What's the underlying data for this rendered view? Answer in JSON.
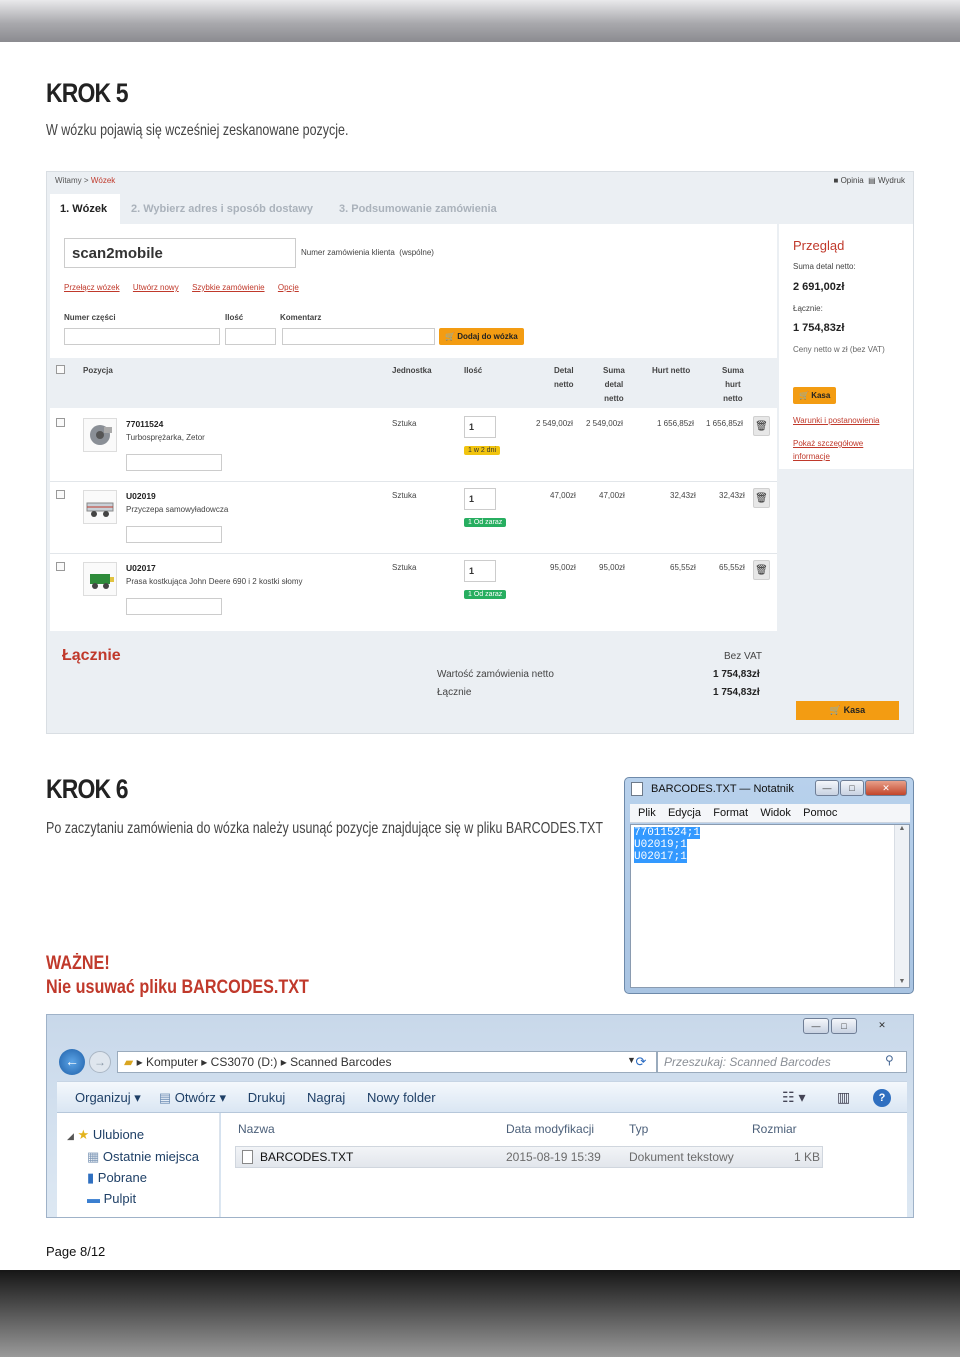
{
  "page": {
    "step5_title": "KROK 5",
    "step5_text": "W wózku pojawią się wcześniej zeskanowane pozycje.",
    "step6_title": "KROK 6",
    "step6_text": "Po zaczytaniu zamówienia do wózka należy usunąć pozycje znajdujące się w pliku BARCODES.TXT",
    "warning_title": "WAŻNE!",
    "warning_text": "Nie usuwać pliku BARCODES.TXT",
    "footer": "Page 8/12"
  },
  "shop": {
    "breadcrumb": {
      "home": "Witamy",
      "sep": ">",
      "current": "Wózek"
    },
    "tools": {
      "opinion": "Opinia",
      "print": "Wydruk"
    },
    "tabs": [
      "1.  Wózek",
      "2.  Wybierz adres i sposób dostawy",
      "3.  Podsumowanie zamówienia"
    ],
    "cart_name": "scan2mobile",
    "client_order_label": "Numer zamówienia klienta",
    "client_order_note": "(wspólne)",
    "links": [
      "Przełącz wózek",
      "Utwórz nowy",
      "Szybkie zamówienie",
      "Opcje"
    ],
    "add_form": {
      "part_label": "Numer części",
      "qty_label": "Ilość",
      "comment_label": "Komentarz",
      "add_button": "Dodaj do wózka"
    },
    "table_headers": {
      "position": "Pozycja",
      "unit": "Jednostka",
      "qty": "Ilość",
      "detal_1": "Detal",
      "detal_2": "netto",
      "suma_detal_1": "Suma",
      "suma_detal_2": "detal",
      "suma_detal_3": "netto",
      "hurt": "Hurt netto",
      "suma_hurt_1": "Suma",
      "suma_hurt_2": "hurt",
      "suma_hurt_3": "netto"
    },
    "rows": [
      {
        "code": "77011524",
        "name": "Turbosprężarka, Zetor",
        "unit": "Sztuka",
        "qty": "1",
        "availability": "1 w 2 dni",
        "detal": "2 549,00zł",
        "suma_detal": "2 549,00zł",
        "hurt": "1 656,85zł",
        "suma_hurt": "1 656,85zł"
      },
      {
        "code": "U02019",
        "name": "Przyczepa samowyładowcza",
        "unit": "Sztuka",
        "qty": "1",
        "availability": "1 Od zaraz",
        "detal": "47,00zł",
        "suma_detal": "47,00zł",
        "hurt": "32,43zł",
        "suma_hurt": "32,43zł"
      },
      {
        "code": "U02017",
        "name": "Prasa kostkująca John Deere 690 i 2 kostki słomy",
        "unit": "Sztuka",
        "qty": "1",
        "availability": "1 Od zaraz",
        "detal": "95,00zł",
        "suma_detal": "95,00zł",
        "hurt": "65,55zł",
        "suma_hurt": "65,55zł"
      }
    ],
    "overview": {
      "title": "Przegląd",
      "suma_label": "Suma detal netto:",
      "suma_value": "2 691,00zł",
      "total_label": "Łącznie:",
      "total_value": "1 754,83zł",
      "note": "Ceny netto w zł (bez VAT)",
      "checkout": "Kasa",
      "terms_link": "Warunki i postanowienia",
      "details_link_1": "Pokaż szczegółowe",
      "details_link_2": "informacje"
    },
    "totals": {
      "title": "Łącznie",
      "col_header": "Bez VAT",
      "order_label": "Wartość zamówienia netto",
      "order_value": "1 754,83zł",
      "total_label": "Łącznie",
      "total_value": "1 754,83zł",
      "checkout": "Kasa"
    },
    "colors": {
      "accent": "#c0392b",
      "button": "#f39c12",
      "green": "#27ae60",
      "yellow": "#f1c40f"
    }
  },
  "notepad": {
    "title": "BARCODES.TXT — Notatnik",
    "menu": [
      "Plik",
      "Edycja",
      "Format",
      "Widok",
      "Pomoc"
    ],
    "lines": [
      "77011524;1",
      "U02019;1",
      "U02017;1"
    ],
    "controls": {
      "min": "—",
      "max": "□",
      "close": "✕"
    }
  },
  "explorer": {
    "breadcrumb": [
      "Komputer",
      "CS3070 (D:)",
      "Scanned Barcodes"
    ],
    "search_placeholder": "Przeszukaj: Scanned Barcodes",
    "toolbar": {
      "organize": "Organizuj",
      "open": "Otwórz",
      "print": "Drukuj",
      "burn": "Nagraj",
      "new_folder": "Nowy folder"
    },
    "sidebar": {
      "favorites": "Ulubione",
      "items": [
        "Ostatnie miejsca",
        "Pobrane",
        "Pulpit"
      ]
    },
    "columns": {
      "name": "Nazwa",
      "modified": "Data modyfikacji",
      "type": "Typ",
      "size": "Rozmiar"
    },
    "file": {
      "name": "BARCODES.TXT",
      "modified": "2015-08-19 15:39",
      "type": "Dokument tekstowy",
      "size": "1 KB"
    },
    "icons": [
      "back-arrow-icon",
      "forward-arrow-icon",
      "folder-icon",
      "refresh-icon",
      "search-icon",
      "view-icon",
      "preview-pane-icon",
      "help-icon",
      "star-icon",
      "recent-places-icon",
      "downloads-icon",
      "desktop-icon",
      "text-file-icon"
    ]
  }
}
